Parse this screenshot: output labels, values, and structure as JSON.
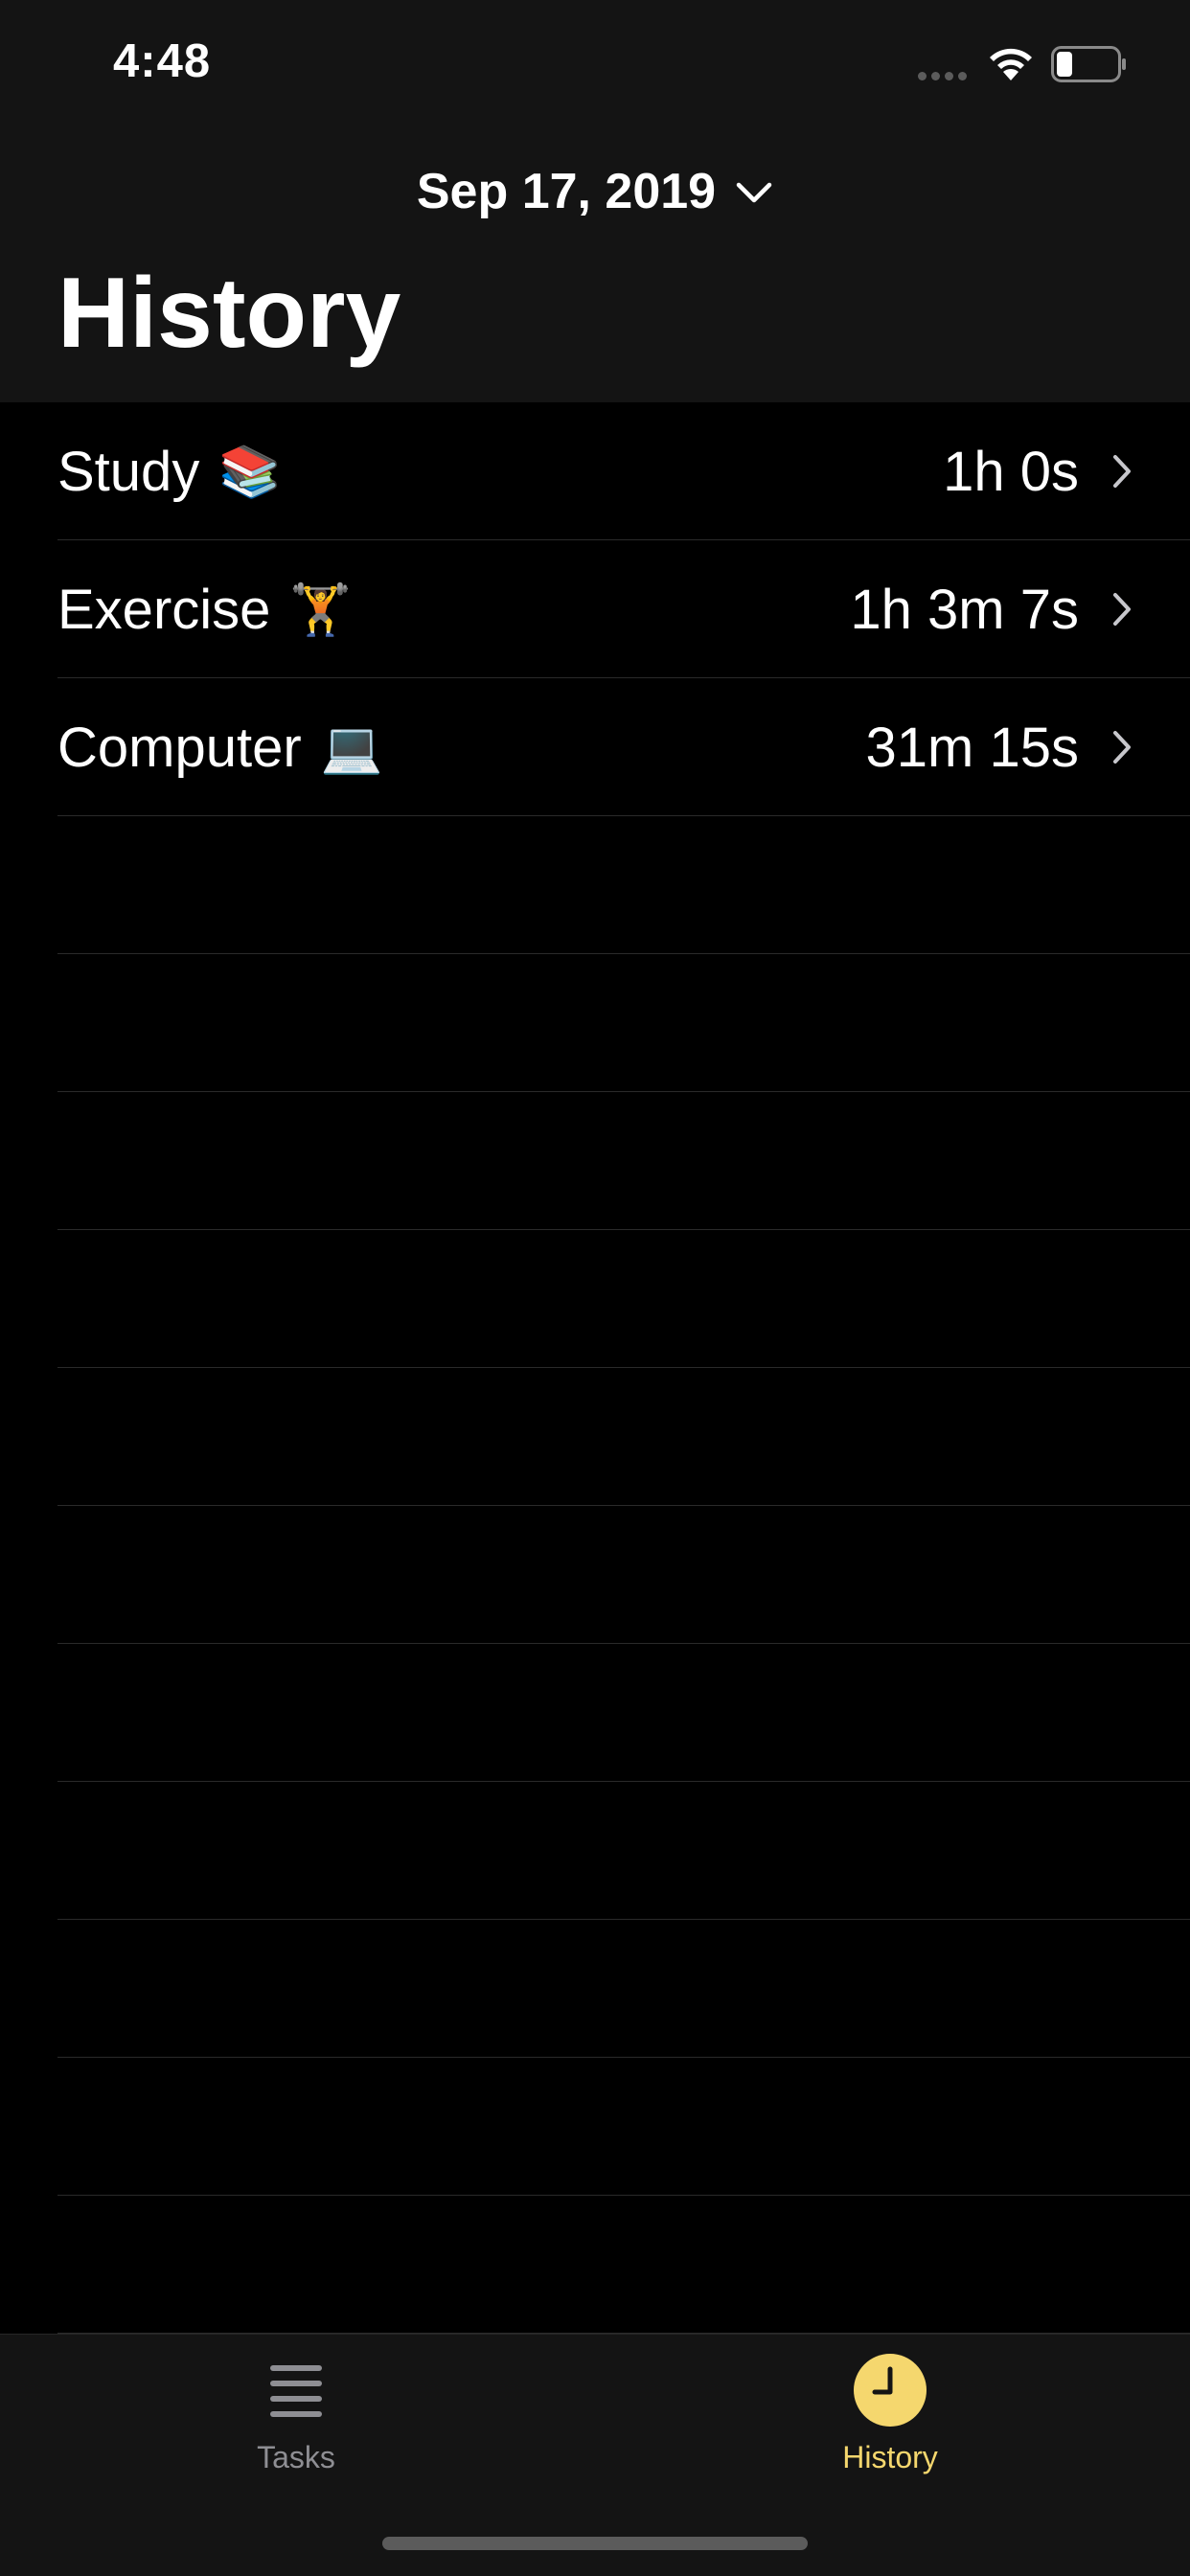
{
  "status_bar": {
    "time": "4:48"
  },
  "header": {
    "date": "Sep 17, 2019",
    "title": "History"
  },
  "history_items": [
    {
      "label": "Study",
      "emoji": "📚",
      "duration": "1h 0s"
    },
    {
      "label": "Exercise",
      "emoji": "🏋️",
      "duration": "1h 3m 7s"
    },
    {
      "label": "Computer",
      "emoji": "💻",
      "duration": "31m 15s"
    }
  ],
  "tab_bar": {
    "tasks_label": "Tasks",
    "history_label": "History"
  },
  "colors": {
    "background": "#000000",
    "bar_background": "#141414",
    "accent": "#f5d76e",
    "inactive_tab": "#8e8e93",
    "separator": "#2a2a2a"
  },
  "icons": {
    "date_dropdown": "chevron-down-icon",
    "row_disclosure": "chevron-right-icon",
    "tasks_tab": "list-icon",
    "history_tab": "clock-icon"
  }
}
